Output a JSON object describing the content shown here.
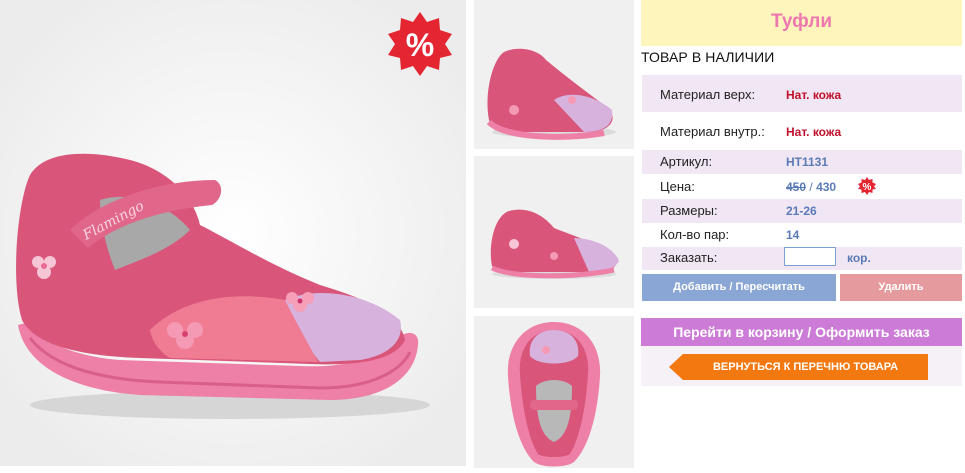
{
  "product": {
    "title": "Туфли",
    "stock_status": "ТОВАР В НАЛИЧИИ",
    "sale_badge_symbol": "%",
    "brand_imprint": "Flamingo"
  },
  "specs": {
    "upper_label": "Материал верх:",
    "upper_value": "Нат. кожа",
    "inner_label": "Материал внутр.:",
    "inner_value": "Нат. кожа",
    "sku_label": "Артикул:",
    "sku_value": "НТ1131",
    "price_label": "Цена:",
    "price_old": "450",
    "price_separator": "/",
    "price_new": "430",
    "price_badge_symbol": "%",
    "sizes_label": "Размеры:",
    "sizes_value": "21-26",
    "pairs_label": "Кол-во пар:",
    "pairs_value": "14",
    "order_label": "Заказать:",
    "order_unit": "кор.",
    "order_qty_value": ""
  },
  "actions": {
    "add_label": "Добавить / Пересчитать",
    "delete_label": "Удалить",
    "cart_label": "Перейти в корзину / Оформить заказ",
    "back_label": "ВЕРНУТЬСЯ К ПЕРЕЧНЮ ТОВАРА"
  },
  "colors": {
    "title_bg": "#fdf5bc",
    "title_text": "#ef77b0",
    "row_alt_bg": "#f1e6f3",
    "value_red": "#c0102c",
    "value_blue": "#5a7bb6",
    "add_button": "#8aa6d4",
    "delete_button": "#e59a9d",
    "cart_button": "#cc7bd6",
    "back_button": "#f2780f",
    "badge_red": "#e32632"
  }
}
